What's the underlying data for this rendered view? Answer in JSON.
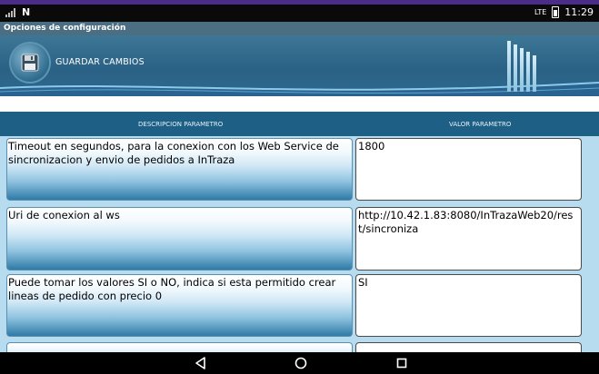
{
  "status_bar": {
    "network": "LTE",
    "time": "11:29"
  },
  "window_title": "Opciones de configuración",
  "header": {
    "save_label": "GUARDAR CAMBIOS"
  },
  "columns": {
    "description": "DESCRIPCION PARAMETRO",
    "value": "VALOR PARAMETRO"
  },
  "params": [
    {
      "description": "Timeout en segundos, para la conexion con los Web Service de sincronizacion y envio de pedidos a InTraza",
      "value": "1800"
    },
    {
      "description": "Uri de conexion al ws",
      "value": "http://10.42.1.83:8080/InTrazaWeb20/rest/sincroniza"
    },
    {
      "description": "Puede tomar los valores SI o NO, indica si esta permitido crear lineas de pedido con precio 0",
      "value": "SI"
    },
    {
      "description": "",
      "value": ""
    }
  ],
  "icons": {
    "save": "floppy-disk-icon",
    "back": "back-triangle-icon",
    "home": "home-circle-icon",
    "recents": "recents-square-icon"
  }
}
